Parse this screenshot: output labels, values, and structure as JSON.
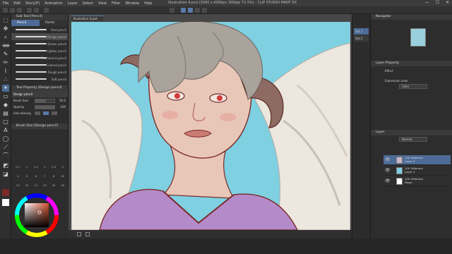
{
  "app": {
    "menu": [
      "File",
      "Edit",
      "Story(P)",
      "Animation",
      "Layer",
      "Select",
      "View",
      "Filter",
      "Window",
      "Help"
    ],
    "title": "Illustration 4.psd (3000 x 4000px 300dpi 73.3%) - CLIP STUDIO PAINT EX",
    "window_controls": [
      "—",
      "☐",
      "✕"
    ]
  },
  "tools": [
    "select",
    "move",
    "zoom",
    "eyedropper",
    "pen",
    "pencil",
    "brush",
    "airbrush",
    "decoration",
    "eraser",
    "fill",
    "gradient",
    "figure",
    "text",
    "balloon",
    "ruler"
  ],
  "subtool": {
    "header": "Sub Tool [Pencil]",
    "tabs": [
      "Pencil",
      "Pastel"
    ],
    "brushes": [
      {
        "name": "Real pencil",
        "active": false
      },
      {
        "name": "Design pencil",
        "active": true
      },
      {
        "name": "Darker pencil",
        "active": false
      },
      {
        "name": "Lighter pencil",
        "active": false
      },
      {
        "name": "Mechanical pencil",
        "active": false
      },
      {
        "name": "Colored pencil",
        "active": false
      },
      {
        "name": "Rough pencil",
        "active": false
      },
      {
        "name": "Soft pencil",
        "active": false
      }
    ]
  },
  "tool_property": {
    "header": "Tool Property [Design pencil]",
    "label": "Design pencil",
    "brush_size_label": "Brush Size",
    "brush_size_value": "50.0",
    "brush_size_fraction": 0.55,
    "opacity_label": "Opacity",
    "opacity_value": "100",
    "opacity_fraction": 1.0,
    "antialias_label": "Anti-aliasing"
  },
  "brush_size_panel": {
    "header": "Brush Size [Design pencil]",
    "sizes": [
      "0.7",
      "1",
      "1.5",
      "2",
      "2.5",
      "3",
      "4",
      "5",
      "6",
      "7",
      "8",
      "10",
      "12",
      "15",
      "17",
      "20",
      "25",
      "30"
    ]
  },
  "canvas": {
    "tab_label": "Illustration 4.psd"
  },
  "subview": {
    "items": [
      "Sat 1",
      "Sat 2"
    ]
  },
  "navigator": {
    "header": "Navigator"
  },
  "layer_property": {
    "header": "Layer Property",
    "effect_label": "Effect",
    "expression_label": "Expression color",
    "expression_value": "Color"
  },
  "layer_panel": {
    "header": "Layer",
    "blend_mode": "Normal",
    "layers": [
      {
        "line1": "100 %Normal",
        "line2": "Layer 3",
        "active": true,
        "thumb": "#c8b7c8"
      },
      {
        "line1": "100 %Normal",
        "line2": "Layer 2",
        "active": false,
        "thumb": "#7fcfe0"
      },
      {
        "line1": "100 %Normal",
        "line2": "Paper",
        "active": false,
        "thumb": "#ffffff"
      }
    ]
  },
  "colors": {
    "accent": "#4d6b96",
    "sky": "#7fd0e1",
    "skin": "#e9c7b8",
    "hair": "#a9a39c",
    "shirt": "#b58ac9",
    "line": "#7a2a28",
    "wing": "#ece7df"
  }
}
